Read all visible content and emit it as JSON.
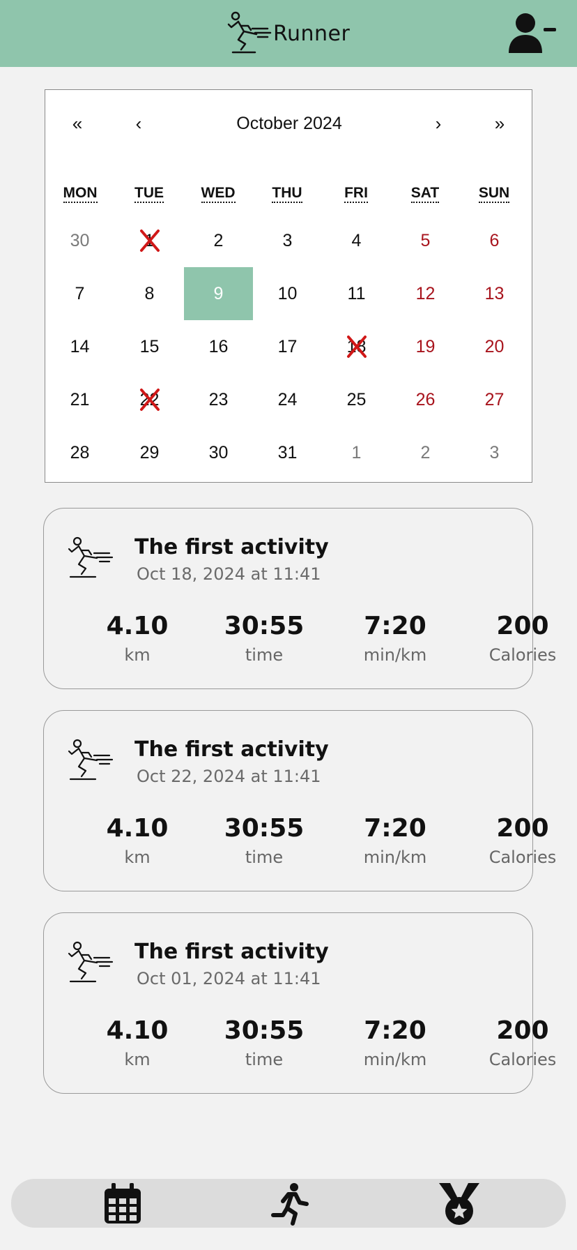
{
  "app": {
    "title": "Runner",
    "brand_color": "#8fc5ac"
  },
  "header": {
    "logo_icon": "runner-logo-icon",
    "user_icon": "user-minus-icon"
  },
  "calendar": {
    "nav": {
      "prev_year": "«",
      "prev_month": "‹",
      "title": "October 2024",
      "next_month": "›",
      "next_year": "»"
    },
    "weekdays": [
      "MON",
      "TUE",
      "WED",
      "THU",
      "FRI",
      "SAT",
      "SUN"
    ],
    "weeks": [
      [
        {
          "d": "30",
          "t": "other"
        },
        {
          "d": "1",
          "t": "",
          "x": true
        },
        {
          "d": "2",
          "t": ""
        },
        {
          "d": "3",
          "t": ""
        },
        {
          "d": "4",
          "t": ""
        },
        {
          "d": "5",
          "t": "weekend"
        },
        {
          "d": "6",
          "t": "weekend"
        }
      ],
      [
        {
          "d": "7",
          "t": ""
        },
        {
          "d": "8",
          "t": ""
        },
        {
          "d": "9",
          "t": "today"
        },
        {
          "d": "10",
          "t": ""
        },
        {
          "d": "11",
          "t": ""
        },
        {
          "d": "12",
          "t": "weekend"
        },
        {
          "d": "13",
          "t": "weekend"
        }
      ],
      [
        {
          "d": "14",
          "t": ""
        },
        {
          "d": "15",
          "t": ""
        },
        {
          "d": "16",
          "t": ""
        },
        {
          "d": "17",
          "t": ""
        },
        {
          "d": "18",
          "t": "",
          "x": true
        },
        {
          "d": "19",
          "t": "weekend"
        },
        {
          "d": "20",
          "t": "weekend"
        }
      ],
      [
        {
          "d": "21",
          "t": ""
        },
        {
          "d": "22",
          "t": "",
          "x": true
        },
        {
          "d": "23",
          "t": ""
        },
        {
          "d": "24",
          "t": ""
        },
        {
          "d": "25",
          "t": ""
        },
        {
          "d": "26",
          "t": "weekend"
        },
        {
          "d": "27",
          "t": "weekend"
        }
      ],
      [
        {
          "d": "28",
          "t": ""
        },
        {
          "d": "29",
          "t": ""
        },
        {
          "d": "30",
          "t": ""
        },
        {
          "d": "31",
          "t": ""
        },
        {
          "d": "1",
          "t": "other"
        },
        {
          "d": "2",
          "t": "other"
        },
        {
          "d": "3",
          "t": "other"
        }
      ]
    ],
    "colors": {
      "weekend": "#a8141d",
      "marker": "#d01818",
      "today_bg": "#8fc5ac"
    }
  },
  "activities": [
    {
      "title": "The first activity",
      "date": "Oct 18, 2024 at 11:41",
      "distance": "4.10",
      "distance_unit": "km",
      "time": "30:55",
      "time_unit": "time",
      "pace": "7:20",
      "pace_unit": "min/km",
      "calories": "200",
      "calories_unit": "Calories"
    },
    {
      "title": "The first activity",
      "date": "Oct 22, 2024 at 11:41",
      "distance": "4.10",
      "distance_unit": "km",
      "time": "30:55",
      "time_unit": "time",
      "pace": "7:20",
      "pace_unit": "min/km",
      "calories": "200",
      "calories_unit": "Calories"
    },
    {
      "title": "The first activity",
      "date": "Oct 01, 2024 at 11:41",
      "distance": "4.10",
      "distance_unit": "km",
      "time": "30:55",
      "time_unit": "time",
      "pace": "7:20",
      "pace_unit": "min/km",
      "calories": "200",
      "calories_unit": "Calories"
    }
  ],
  "bottom_nav": {
    "items": [
      "calendar-icon",
      "running-icon",
      "medal-icon"
    ]
  }
}
